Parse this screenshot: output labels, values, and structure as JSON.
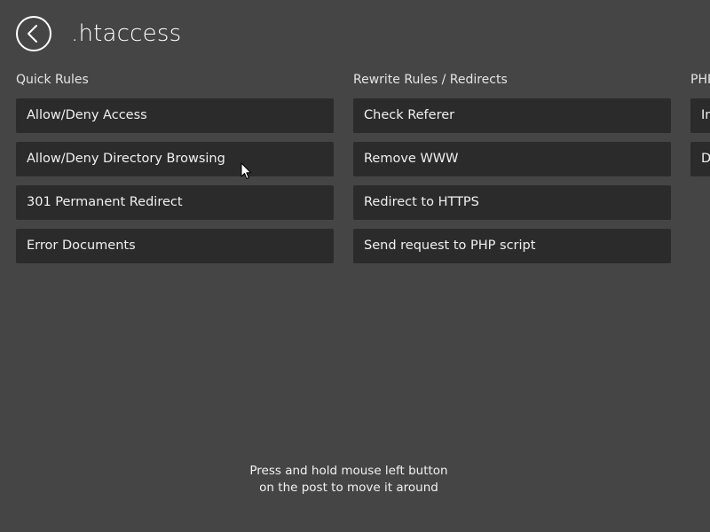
{
  "header": {
    "back_icon": "back-arrow-icon",
    "title": ".htaccess"
  },
  "columns": [
    {
      "title": "Quick Rules",
      "items": [
        {
          "label": "Allow/Deny Access"
        },
        {
          "label": "Allow/Deny Directory Browsing"
        },
        {
          "label": "301 Permanent Redirect"
        },
        {
          "label": "Error Documents"
        }
      ]
    },
    {
      "title": "Rewrite Rules / Redirects",
      "items": [
        {
          "label": "Check Referer"
        },
        {
          "label": "Remove WWW"
        },
        {
          "label": "Redirect to HTTPS"
        },
        {
          "label": "Send request to PHP script"
        }
      ]
    },
    {
      "title": "PHP",
      "items": [
        {
          "label": "In"
        },
        {
          "label": "D"
        }
      ]
    }
  ],
  "hint": {
    "line1": "Press and hold mouse left button",
    "line2": "on the post to move it around"
  },
  "colors": {
    "background": "#454545",
    "tile": "#2b2b2b",
    "text": "#ffffff"
  }
}
